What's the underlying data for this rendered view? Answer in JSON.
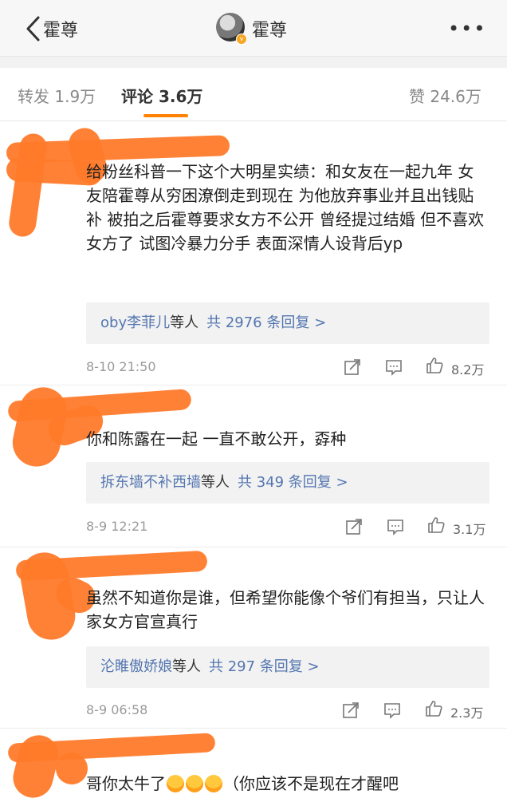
{
  "nav": {
    "back_label": "霍尊",
    "title": "霍尊",
    "more": "•••"
  },
  "tabs": [
    {
      "label": "转发 1.9万"
    },
    {
      "label": "评论 3.6万"
    },
    {
      "label": "赞 24.6万"
    }
  ],
  "comments": [
    {
      "text": "给粉丝科普一下这个大明星实绩：和女友在一起九年 女友陪霍尊从穷困潦倒走到现在 为他放弃事业并且出钱贴补 被拍之后霍尊要求女方不公开 曾经提过结婚 但不喜欢女方了 试图冷暴力分手 表面深情人设背后yp",
      "replies_user": "oby李菲儿",
      "replies_suffix": "等人",
      "replies_count": "共 2976 条回复 >",
      "time": "8-10 21:50",
      "likes": "8.2万"
    },
    {
      "text": "你和陈露在一起 一直不敢公开，孬种",
      "replies_user": "拆东墙不补西墙",
      "replies_suffix": "等人",
      "replies_count": "共 349 条回复 >",
      "time": "8-9 12:21",
      "likes": "3.1万"
    },
    {
      "text": "虽然不知道你是谁，但希望你能像个爷们有担当，只让人家女方官宣真行",
      "replies_user": "沦睢傲娇娘",
      "replies_suffix": "等人",
      "replies_count": "共 297 条回复 >",
      "time": "8-9 06:58",
      "likes": "2.3万"
    },
    {
      "text_a": "哥你太牛了",
      "text_b": "（你应该不是现在才醒吧"
    }
  ],
  "colors": {
    "accent": "#ff8200",
    "link": "#5476b0",
    "scribble": "#ff7a2a"
  }
}
